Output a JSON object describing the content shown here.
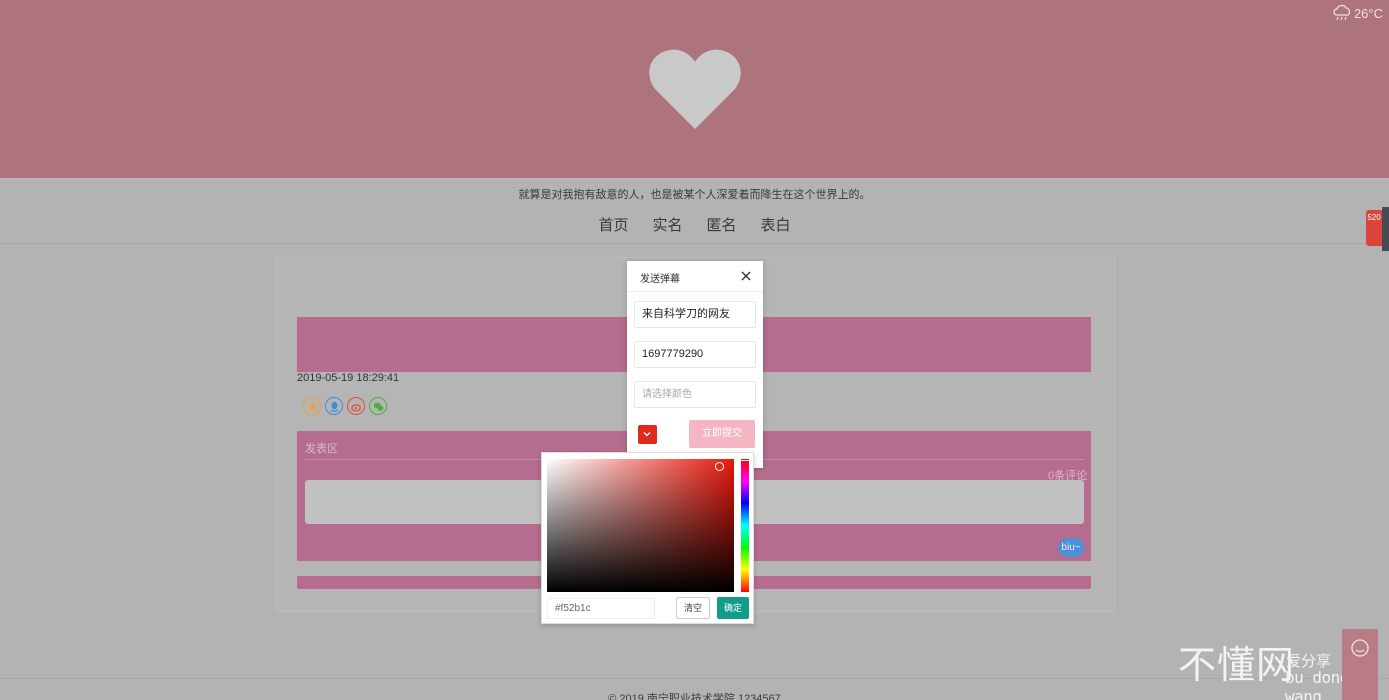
{
  "weather": {
    "temperature": "26°C",
    "icon": "cloud-rain-icon"
  },
  "motto": "就算是对我抱有敌意的人，也是被某个人深爱着而降生在这个世界上的。",
  "nav": {
    "home": "首页",
    "realname": "实名",
    "anonymous": "匿名",
    "confession": "表白"
  },
  "side_tag": "520",
  "post": {
    "date": "2019-05-19 18:29:41",
    "share_icons": [
      "qzone-icon",
      "qq-icon",
      "weibo-icon",
      "wechat-icon"
    ]
  },
  "comments": {
    "label": "发表区",
    "count": "0条评论",
    "send_label": "biu~"
  },
  "dialog": {
    "title": "发送弹幕",
    "name_value": "来自科学刀的网友",
    "qq_value": "1697779290",
    "color_placeholder": "请选择颜色",
    "submit_label": "立即提交"
  },
  "color_picker": {
    "hex_value": "#f52b1c",
    "clear_label": "清空",
    "confirm_label": "确定",
    "selected_color": "#e02a1c"
  },
  "footer": "© 2019 南宁职业技术学院   1234567",
  "watermark": {
    "main": "不懂网",
    "slogan": "爱分享",
    "pinyin": "bu dong wang"
  },
  "colors": {
    "hero": "#ad747d",
    "pink": "#b66c8e",
    "submit": "#f5b6c4",
    "confirm": "#129d8b"
  }
}
